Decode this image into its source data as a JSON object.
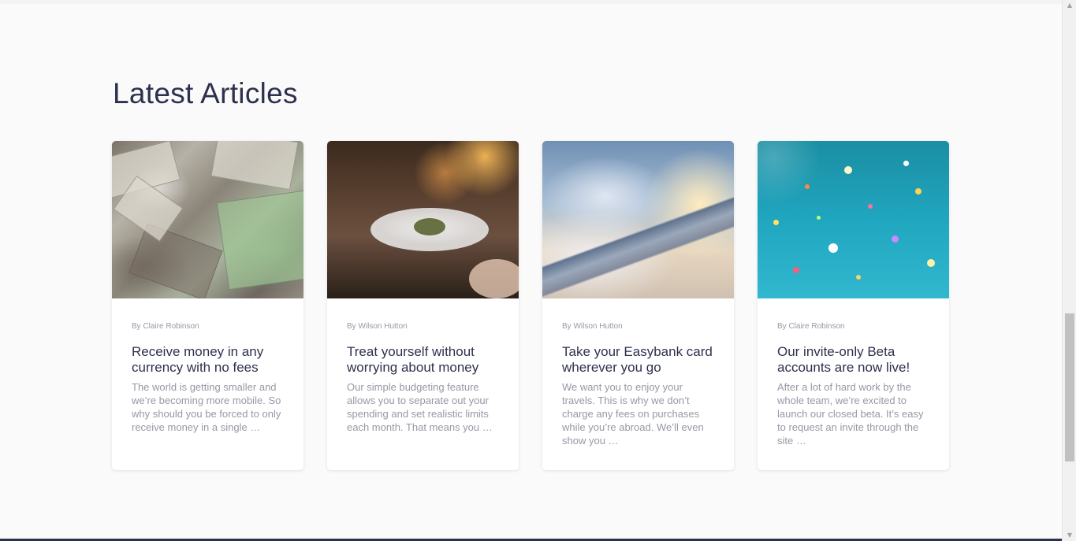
{
  "section": {
    "title": "Latest Articles"
  },
  "articles": [
    {
      "author": "By Claire Robinson",
      "title": "Receive money in any currency with no fees",
      "excerpt": "The world is getting smaller and we’re becoming more mobile. So why should you be forced to only receive money in a single …",
      "image": "currency-banknotes"
    },
    {
      "author": "By Wilson Hutton",
      "title": "Treat yourself without worrying about money",
      "excerpt": "Our simple budgeting feature allows you to separate out your spending and set realistic limits each month. That means you …",
      "image": "restaurant-plate"
    },
    {
      "author": "By Wilson Hutton",
      "title": "Take your Easybank card wherever you go",
      "excerpt": "We want you to enjoy your travels. This is why we don’t charge any fees on purchases while you’re abroad. We’ll even show you …",
      "image": "airplane-wing"
    },
    {
      "author": "By Claire Robinson",
      "title": "Our invite-only Beta accounts are now live!",
      "excerpt": "After a lot of hard work by the whole team, we’re excited to launch our closed beta. It’s easy to request an invite through the site …",
      "image": "confetti"
    }
  ],
  "colors": {
    "background": "#fafafa",
    "heading": "#2d314d",
    "muted": "#9698a6",
    "card": "#ffffff"
  },
  "icons": {
    "scroll_up": "scroll-up-arrow-icon",
    "scroll_down": "scroll-down-arrow-icon"
  }
}
